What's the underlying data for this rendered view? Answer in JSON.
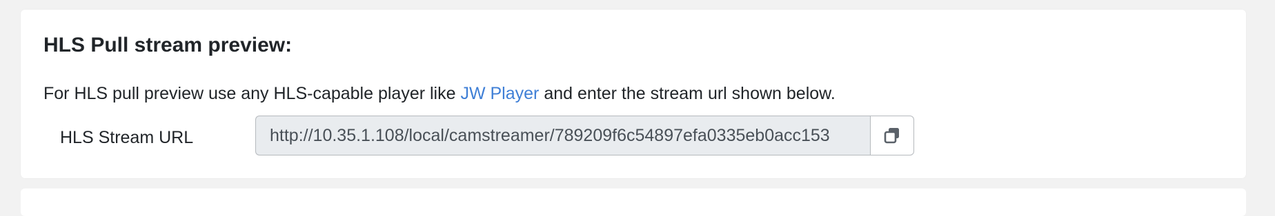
{
  "section": {
    "title": "HLS Pull stream preview:",
    "description_before": "For HLS pull preview use any HLS-capable player like ",
    "link_text": "JW Player",
    "description_after": " and enter the stream url shown below."
  },
  "stream_url": {
    "label": "HLS Stream URL",
    "value": "http://10.35.1.108/local/camstreamer/789209f6c54897efa0335eb0acc153"
  },
  "copy_button": {
    "icon": "copy-icon"
  },
  "colors": {
    "link": "#3f7fd6",
    "input_background": "#e9ecef",
    "page_background": "#f2f2f2"
  }
}
